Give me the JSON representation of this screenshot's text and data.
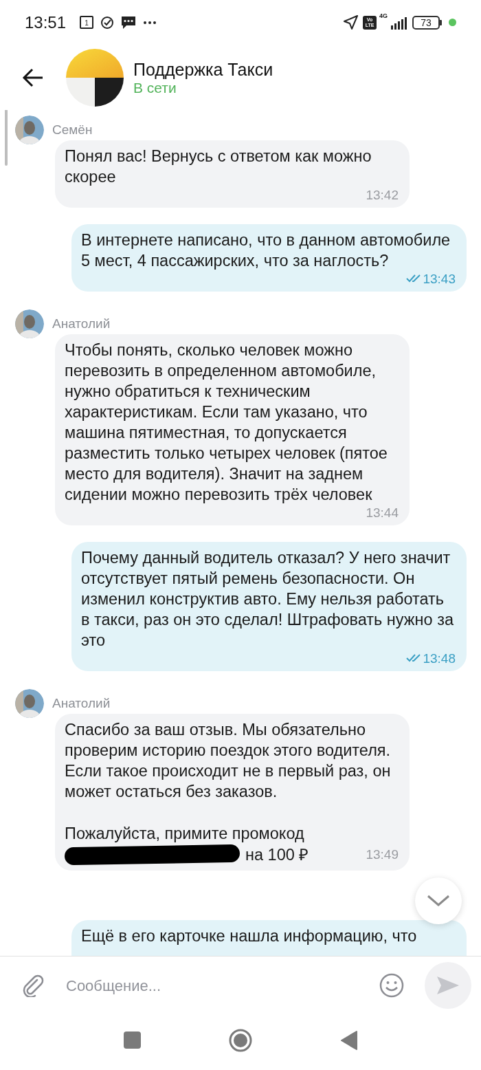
{
  "status_bar": {
    "time": "13:51",
    "calendar_day": "1",
    "volte": [
      "Vo",
      "LTE"
    ],
    "network_type": "4G",
    "battery": "73"
  },
  "header": {
    "title": "Поддержка Такси",
    "status": "В сети"
  },
  "messages": [
    {
      "kind": "incoming",
      "sender": "Семён",
      "paragraphs": [
        "Понял вас! Вернусь с ответом как можно скорее"
      ],
      "time": "13:42"
    },
    {
      "kind": "outgoing",
      "paragraphs": [
        "В интернете написано, что в данном автомобиле 5 мест, 4 пассажирских, что за наглость?"
      ],
      "time": "13:43",
      "read": true
    },
    {
      "kind": "incoming",
      "sender": "Анатолий",
      "paragraphs": [
        "Чтобы понять, сколько человек можно перевозить в определенном автомобиле, нужно обратиться к техническим характеристикам. Если там указано, что машина пятиместная, то допускается разместить только четырех человек (пятое место для водителя). Значит на заднем сидении можно перевозить трёх человек"
      ],
      "time": "13:44"
    },
    {
      "kind": "outgoing",
      "paragraphs": [
        "Почему данный водитель отказал? У него значит отсутствует пятый ремень безопасности. Он изменил конструктив авто. Ему нельзя работать в такси, раз он это сделал! Штрафовать нужно за это"
      ],
      "time": "13:48",
      "read": true
    },
    {
      "kind": "incoming",
      "sender": "Анатолий",
      "paragraphs": [
        "Спасибо за ваш отзыв. Мы обязательно проверим историю поездок этого водителя. Если такое происходит не в первый раз, он может остаться без заказов.",
        "Пожалуйста, примите промокод"
      ],
      "promo_suffix": "на 100 ₽",
      "time": "13:49"
    },
    {
      "kind": "outgoing",
      "paragraphs": [
        "Ещё в его карточке нашла информацию, что"
      ],
      "cut_off": true
    }
  ],
  "composer": {
    "placeholder": "Сообщение..."
  }
}
